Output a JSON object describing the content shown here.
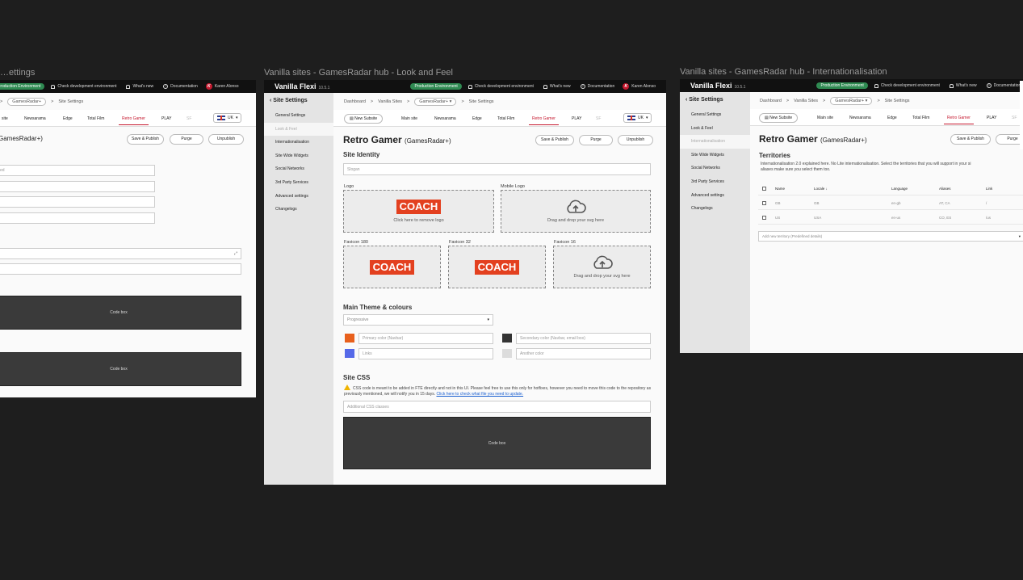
{
  "frames": {
    "left": {
      "title": "…ettings"
    },
    "center": {
      "title": "Vanilla sites - GamesRadar hub - Look and Feel"
    },
    "right": {
      "title": "Vanilla sites - GamesRadar hub - Internationalisation"
    }
  },
  "topbar": {
    "brand": "Vanilla Flexi",
    "version": "10.5.1",
    "environment": "Production Environment",
    "check_dev": "Check development environment",
    "whats_new": "What's new",
    "documentation": "Documentation",
    "user_initial": "K",
    "user_name": "Karen Alonso"
  },
  "sidebar": {
    "heading": "Site Settings",
    "items": [
      "General Settings",
      "Look & Feel",
      "Internationalisation",
      "Site Wide Widgets",
      "Social Networks",
      "3rd Party Services",
      "Advanced settings",
      "Changelogs"
    ]
  },
  "breadcrumb": {
    "dashboard": "Dashboard",
    "sites": "Vanilla Sites",
    "hub": "GamesRadar+",
    "page": "Site Settings"
  },
  "tabs": {
    "new_site": "New Subsite",
    "items": [
      "Main site",
      "Newsarama",
      "Edge",
      "Total Film",
      "Retro Gamer",
      "PLAY",
      "SF"
    ],
    "locale": "UK"
  },
  "page": {
    "title": "Retro Gamer",
    "subtitle": "(GamesRadar+)",
    "save": "Save & Publish",
    "purge": "Purge",
    "unpublish": "Unpublish"
  },
  "left_frame": {
    "crumb_partial": "site",
    "title_partial": "GamesRadar+)",
    "field_partial": "ed",
    "code_box_1": "Code box",
    "code_box_2": "Code box"
  },
  "identity": {
    "heading": "Site Identity",
    "slogan_placeholder": "Slogan",
    "logo_label": "Logo",
    "logo_text": "COACH",
    "logo_action": "Click here to remove logo",
    "mobile_logo_label": "Mobile Logo",
    "drop_text": "Drag and drop your svg here",
    "fav180_label": "Favicon 180",
    "fav32_label": "Favicon 32",
    "fav16_label": "Favicon 16"
  },
  "theme": {
    "heading": "Main Theme & colours",
    "selected": "Progressive",
    "primary": {
      "placeholder": "Primary color (Navbar)",
      "color": "#e8601c"
    },
    "secondary": {
      "placeholder": "Secondary color (Navbar, email box)",
      "color": "#333333"
    },
    "links": {
      "placeholder": "Links",
      "color": "#5569e8"
    },
    "another": {
      "placeholder": "Another color",
      "color": "#dcdcdc"
    }
  },
  "css": {
    "heading": "Site CSS",
    "warning": "CSS code is meant to be added in FTE directly and not in this UI. Please feel free to use this only for hotfixes, however you need to move this code to the repository as previously mentioned, we will notify you in 15 days.",
    "link": "Click here to check what file you need to update.",
    "classes_placeholder": "Additional CSS classes",
    "code_box": "Code box"
  },
  "territories": {
    "heading": "Territories",
    "description": "Internationalisation 2.0 explained here. No Lite internationalisation. Select the territories that you will support in your si",
    "description2": "aliases make sure you select them too.",
    "columns": [
      "Name",
      "Locale",
      "Language",
      "Aliases",
      "Link"
    ],
    "rows": [
      {
        "name": "GB",
        "locale": "GB",
        "language": "en-gb",
        "aliases": "AT, CA",
        "link": "/"
      },
      {
        "name": "US",
        "locale": "USA",
        "language": "en-us",
        "aliases": "CO, ES",
        "link": "/us"
      }
    ],
    "add_placeholder": "Add new territory (Predefined details)"
  }
}
